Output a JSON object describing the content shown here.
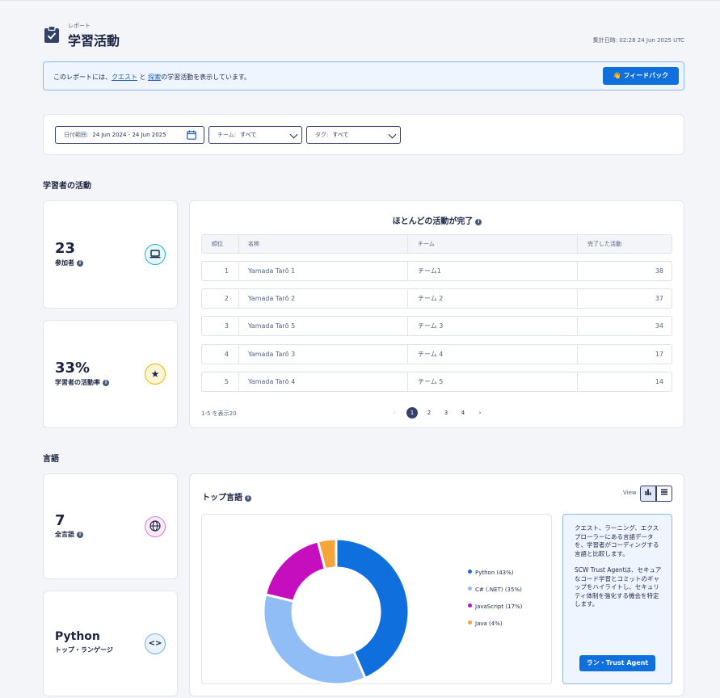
{
  "header": {
    "eyebrow": "レポート",
    "title": "学習活動",
    "timestamp": "集計日時: 02:28 24 Jun 2025 UTC"
  },
  "banner": {
    "text_before": "このレポートには、",
    "link_quest": "クエスト",
    "text_and": " と ",
    "link_explore": "探索",
    "text_after": "の学習活動を表示しています。",
    "feedback_button": "👋 フィードバック"
  },
  "filters": {
    "date_label": "日付範囲:",
    "date_value": "24 Jun 2024 - 24 Jun 2025",
    "team_label": "チーム:",
    "team_value": "すべて",
    "tag_label": "タグ:",
    "tag_value": "すべて"
  },
  "learner_section": {
    "title": "学習者の活動",
    "participants_value": "23",
    "participants_label": "参加者",
    "rate_value": "33%",
    "rate_label": "学習者の活動率"
  },
  "leaderboard": {
    "title": "ほとんどの活動が完了",
    "columns": [
      "順位",
      "名称",
      "チーム",
      "完了した活動"
    ],
    "rows": [
      {
        "rank": "1",
        "name": "Yamada Tarō 1",
        "team": "チーム1",
        "count": "38"
      },
      {
        "rank": "2",
        "name": "Yamada Tarō 2",
        "team": "チーム 2",
        "count": "37"
      },
      {
        "rank": "3",
        "name": "Yamada Tarō 5",
        "team": "チーム 3",
        "count": "34"
      },
      {
        "rank": "4",
        "name": "Yamada Tarō 3",
        "team": "チーム 4",
        "count": "17"
      },
      {
        "rank": "5",
        "name": "Yamada Tarō 4",
        "team": "チーム 5",
        "count": "14"
      }
    ],
    "range_text": "1-5 を表示20",
    "pages": [
      "1",
      "2",
      "3",
      "4"
    ],
    "current_page": "1"
  },
  "language_section": {
    "title": "言語",
    "total_value": "7",
    "total_label": "全言語",
    "top_value": "Python",
    "top_label": "トップ・ランゲージ"
  },
  "top_languages": {
    "title": "トップ言語",
    "view_label": "View",
    "info_p1": "クエスト、ラーニング、エクスプローラーにある言語データを、学習者がコーディングする言語と比較します。",
    "info_p2": "SCW Trust Agentは、セキュアなコード学習とコミットのギャップをハイライトし、セキュリティ体制を強化する機会を特定します。",
    "agent_button": "ラン・Trust Agent"
  },
  "chart_data": {
    "type": "pie",
    "donut": true,
    "categories": [
      "Python",
      "C# (.NET)",
      "JavaScript",
      "Java"
    ],
    "values": [
      43,
      35,
      17,
      4
    ],
    "legend_labels": [
      "Python (43%)",
      "C# (.NET) (35%)",
      "JavaScript (17%)",
      "Java (4%)"
    ],
    "colors": [
      "#0f6fdc",
      "#90bdf5",
      "#c50fbf",
      "#f5a43a"
    ],
    "legend_position": "right"
  }
}
